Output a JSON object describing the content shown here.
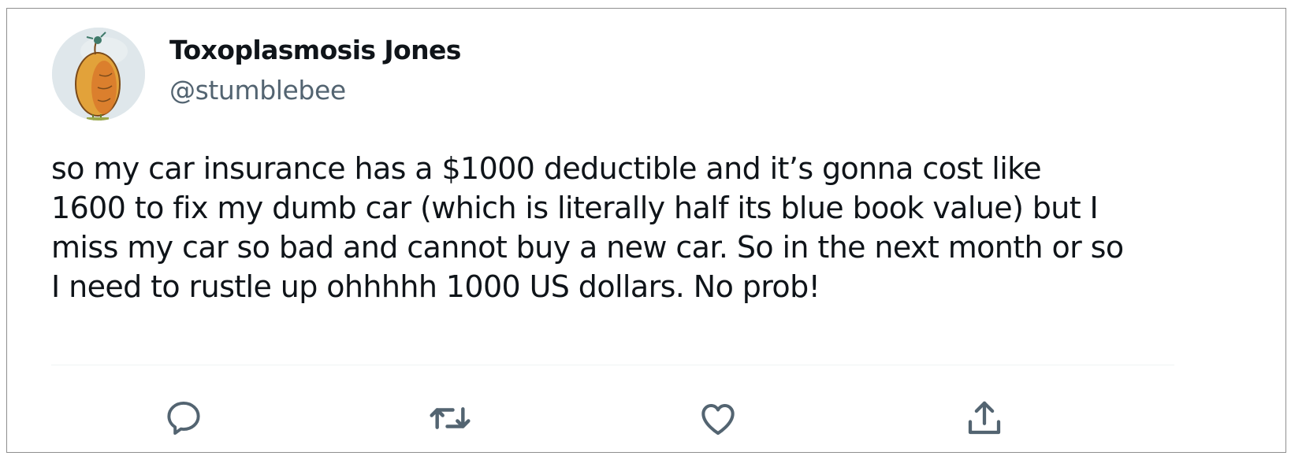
{
  "tweet": {
    "author": {
      "display_name": "Toxoplasmosis Jones",
      "handle": "@stumblebee",
      "avatar_icon": "avatar-image"
    },
    "text_lines": [
      "so my car insurance has a $1000 deductible and it’s gonna cost like",
      "1600 to fix my dumb car (which is literally half its blue book value) but I",
      "miss my car so bad and cannot buy a new car. So in the next month or so",
      "I need to rustle up ohhhhh 1000 US dollars. No prob!"
    ],
    "actions": [
      {
        "name": "reply",
        "icon": "reply-icon"
      },
      {
        "name": "retweet",
        "icon": "retweet-icon"
      },
      {
        "name": "like",
        "icon": "heart-icon"
      },
      {
        "name": "share",
        "icon": "share-icon"
      }
    ]
  },
  "colors": {
    "text_primary": "#0f1419",
    "text_secondary": "#536471",
    "icon": "#536471",
    "divider": "#eff3f4",
    "border": "#8f8f8f"
  }
}
